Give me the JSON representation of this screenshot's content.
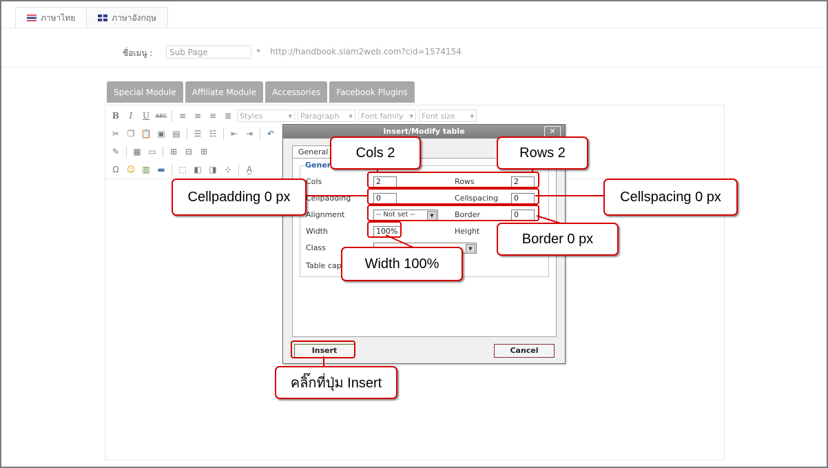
{
  "language_tabs": [
    {
      "label": "ภาษาไทย",
      "icon": "thai-flag-icon"
    },
    {
      "label": "ภาษาอังกฤษ",
      "icon": "uk-flag-icon"
    }
  ],
  "menu": {
    "label": "ชื่อเมนู :",
    "name_value": "Sub Page",
    "link_icon": "link-icon",
    "url": "http://handbook.siam2web.com?cid=1574154"
  },
  "module_tabs": [
    "Special Module",
    "Affiliate Module",
    "Accessories",
    "Facebook Plugins"
  ],
  "toolbar": {
    "selects": {
      "styles": "Styles",
      "paragraph": "Paragraph",
      "font_family": "Font family",
      "font_size": "Font size"
    },
    "bold": "B",
    "italic": "I",
    "underline": "U",
    "strikethrough": "ABC",
    "special_char": "Ω",
    "emoticon": "☺"
  },
  "dialog": {
    "title": "Insert/Modify table",
    "close": "✕",
    "tab_general": "General",
    "legend": "Genera",
    "labels": {
      "cols": "Cols",
      "rows": "Rows",
      "cellpadding": "Cellpadding",
      "cellspacing": "Cellspacing",
      "alignment": "Alignment",
      "border": "Border",
      "width": "Width",
      "height": "Height",
      "class": "Class",
      "table_caption": "Table cap"
    },
    "values": {
      "cols": "2",
      "rows": "2",
      "cellpadding": "0",
      "cellspacing": "0",
      "alignment": "-- Not set --",
      "border": "0",
      "width": "100%",
      "height": "",
      "class": ""
    },
    "insert_button": "Insert",
    "cancel_button": "Cancel"
  },
  "callouts": {
    "cols": "Cols 2",
    "rows": "Rows 2",
    "cellpadding": "Cellpadding 0 px",
    "cellspacing": "Cellspacing 0 px",
    "border": "Border 0 px",
    "width": "Width 100%",
    "insert": "คลิ๊กที่ปุ่ม Insert"
  },
  "colors": {
    "highlight": "#d60000",
    "tab_bg": "#a8a8a8",
    "legend": "#2a5fa8"
  }
}
